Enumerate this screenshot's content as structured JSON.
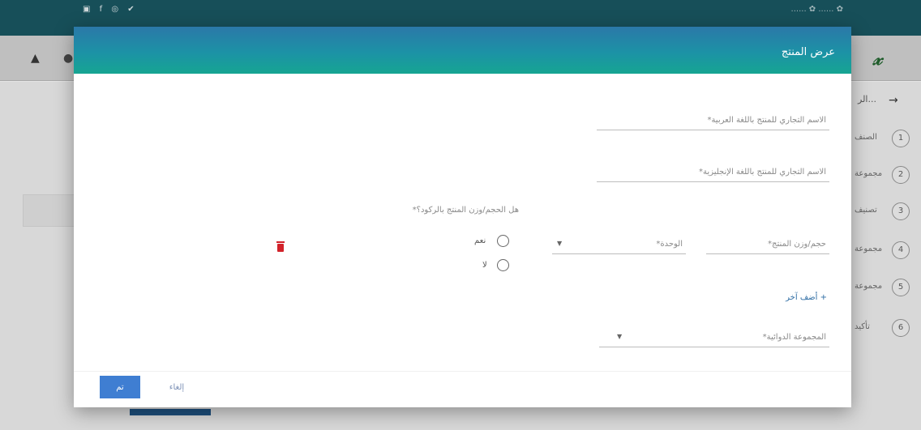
{
  "background": {
    "social_icons": [
      "instagram-icon",
      "facebook-icon",
      "instagram-icon",
      "twitter-icon"
    ],
    "social_text": "▣ f ◎ ✔",
    "lang_text": "...... ✿ ...... ✿",
    "user_icon": "person-icon",
    "logo_text": "𝓍",
    "steps_header": "الر...",
    "steps": [
      {
        "num": "1",
        "label": "الصنف"
      },
      {
        "num": "2",
        "label": "مجموعة"
      },
      {
        "num": "3",
        "label": "تصنيف"
      },
      {
        "num": "4",
        "label": "مجموعة"
      },
      {
        "num": "5",
        "label": "مجموعة"
      },
      {
        "num": "6",
        "label": "تأكيد"
      }
    ]
  },
  "modal": {
    "title": "عرض المنتج",
    "fields": {
      "trade_name_ar": "الاسم التجاري للمنتج باللغة العربية*",
      "trade_name_en": "الاسم التجاري للمنتج باللغة الإنجليزية*",
      "size": "حجم/وزن المنتج*",
      "unit": "الوحدة*",
      "pharma_group": "المجموعة الدوائية*"
    },
    "question": "هل الحجم/وزن المنتج بالركود؟*",
    "radio_yes": "نعم",
    "radio_no": "لا",
    "add_more": "+ أضف آخر",
    "ok_label": "تم",
    "cancel_label": "إلغاء"
  },
  "colors": {
    "header_start": "#2b78a8",
    "header_end": "#16a592",
    "primary": "#3f7ed2",
    "danger": "#d2222a"
  }
}
